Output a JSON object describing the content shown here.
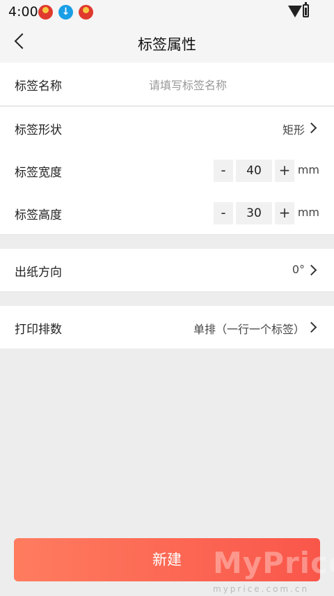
{
  "status_bar": {
    "time": "4:00"
  },
  "header": {
    "title": "标签属性"
  },
  "name_row": {
    "label": "标签名称",
    "placeholder": "请填写标签名称",
    "value": ""
  },
  "shape_row": {
    "label": "标签形状",
    "value": "矩形"
  },
  "width_row": {
    "label": "标签宽度",
    "value": "40",
    "decrement": "-",
    "increment": "+",
    "unit": "mm"
  },
  "height_row": {
    "label": "标签高度",
    "value": "30",
    "decrement": "-",
    "increment": "+",
    "unit": "mm"
  },
  "direction_row": {
    "label": "出纸方向",
    "value": "0°"
  },
  "print_row": {
    "label": "打印排数",
    "value": "单排（一行一个标签）"
  },
  "footer": {
    "new_button_label": "新建"
  },
  "watermark": {
    "text": "MyPrice",
    "subtext": "myprice.com.cn"
  },
  "colors": {
    "accent_start": "#ff7c5f",
    "accent_end": "#f9564a",
    "background": "#ededed"
  }
}
